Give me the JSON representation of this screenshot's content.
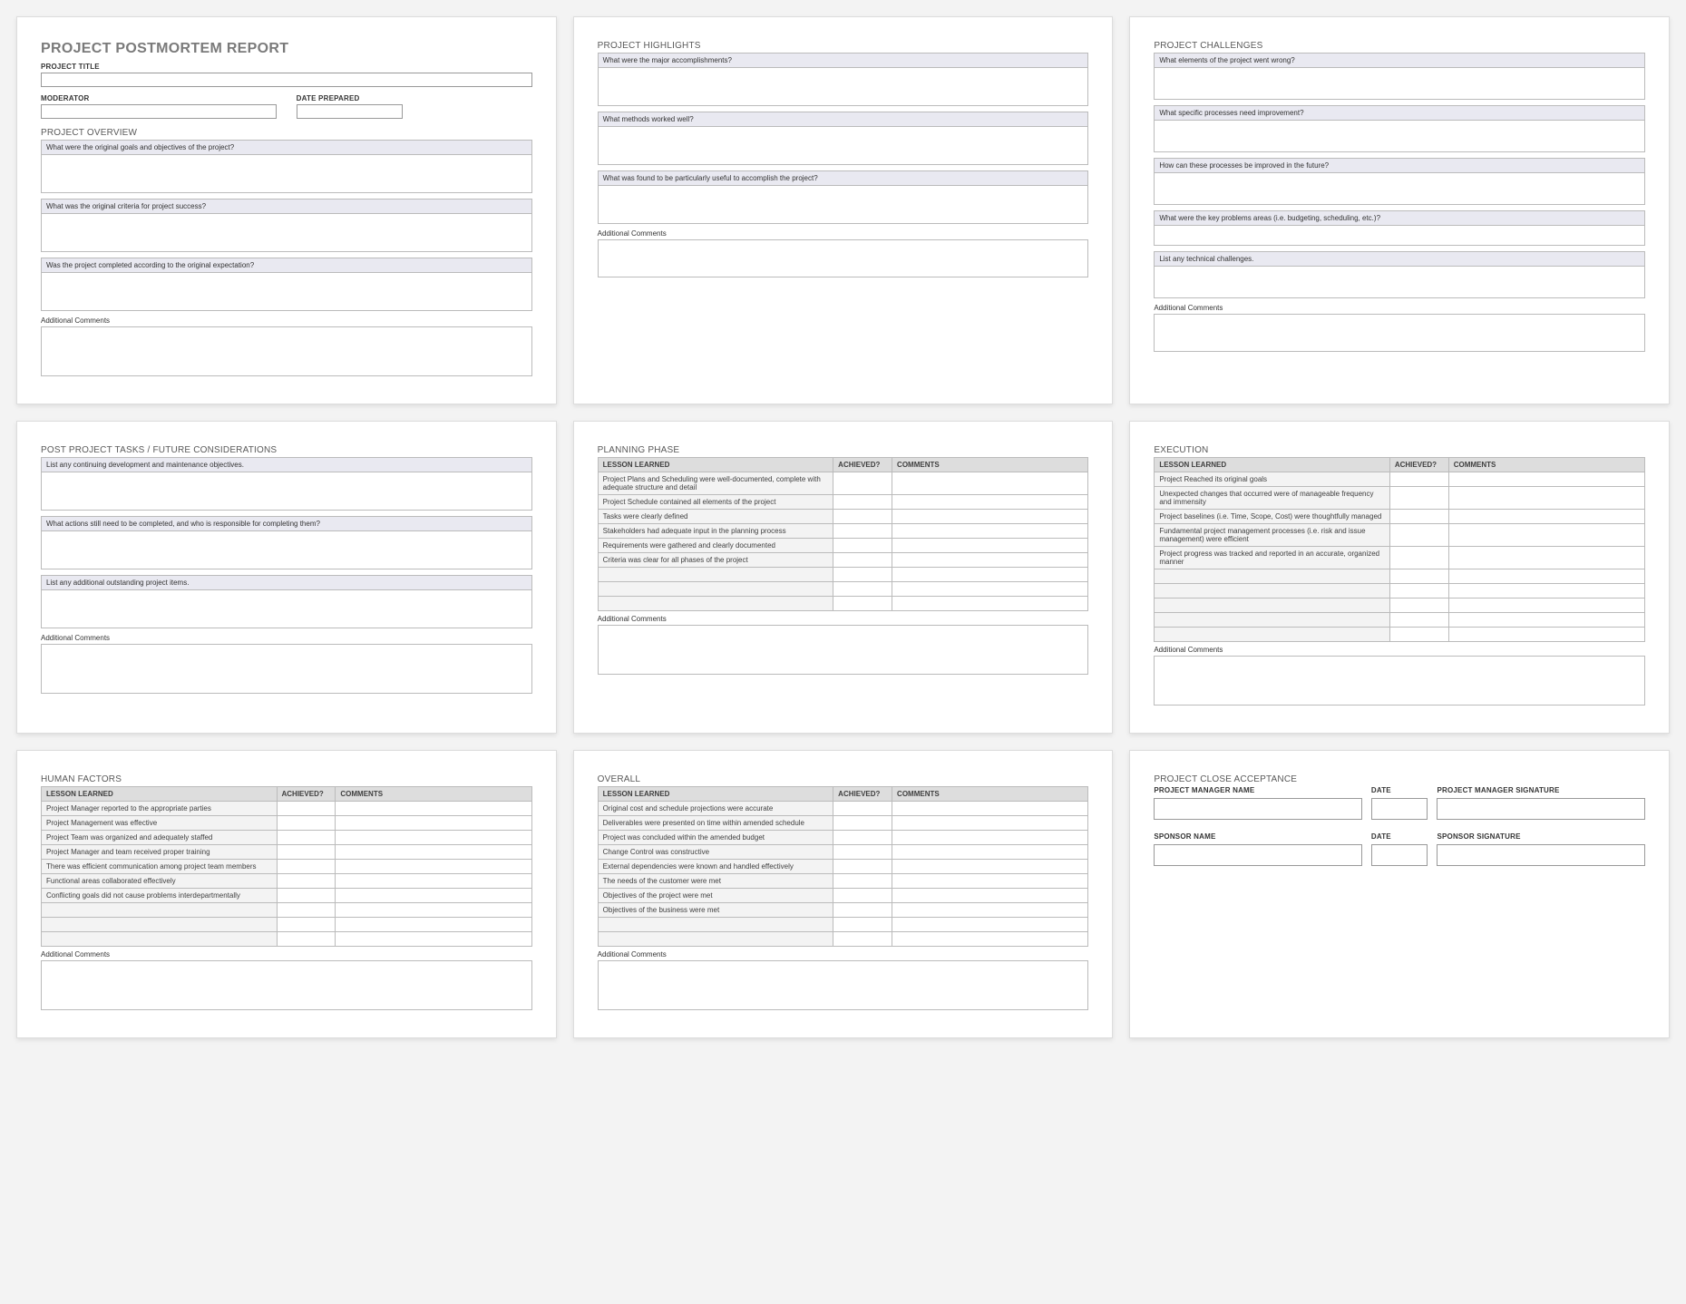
{
  "card1": {
    "title": "PROJECT POSTMORTEM REPORT",
    "project_title_label": "PROJECT TITLE",
    "moderator_label": "MODERATOR",
    "date_prepared_label": "DATE PREPARED",
    "overview_title": "PROJECT OVERVIEW",
    "q1": "What were the original goals and objectives of the project?",
    "q2": "What was the original criteria for project success?",
    "q3": "Was the project completed according to the original expectation?",
    "comments_label": "Additional Comments"
  },
  "card2": {
    "title": "PROJECT HIGHLIGHTS",
    "q1": "What were the major accomplishments?",
    "q2": "What methods worked well?",
    "q3": "What was found to be particularly useful to accomplish the project?",
    "comments_label": "Additional Comments"
  },
  "card3": {
    "title": "PROJECT CHALLENGES",
    "q1": "What elements of the project went wrong?",
    "q2": "What specific processes need improvement?",
    "q3": "How can these processes be improved in the future?",
    "q4": "What were the key problems areas (i.e. budgeting, scheduling, etc.)?",
    "q5": "List any technical challenges.",
    "comments_label": "Additional Comments"
  },
  "card4": {
    "title": "POST PROJECT TASKS / FUTURE CONSIDERATIONS",
    "q1": "List any continuing development and maintenance objectives.",
    "q2": "What actions still need to be completed, and who is responsible for completing them?",
    "q3": "List any additional outstanding project items.",
    "comments_label": "Additional Comments"
  },
  "card5": {
    "title": "PLANNING PHASE",
    "th1": "LESSON LEARNED",
    "th2": "ACHIEVED?",
    "th3": "COMMENTS",
    "rows": [
      "Project Plans and Scheduling were well-documented, complete with adequate structure and detail",
      "Project Schedule contained all elements of the project",
      "Tasks were clearly defined",
      "Stakeholders had adequate input in the planning process",
      "Requirements were gathered and clearly documented",
      "Criteria was clear for all phases of the project"
    ],
    "comments_label": "Additional Comments"
  },
  "card6": {
    "title": "EXECUTION",
    "th1": "LESSON LEARNED",
    "th2": "ACHIEVED?",
    "th3": "COMMENTS",
    "rows": [
      "Project Reached its original goals",
      "Unexpected changes that occurred were of manageable frequency and immensity",
      "Project baselines (i.e. Time, Scope, Cost) were thoughtfully managed",
      "Fundamental project management processes (i.e. risk and issue management) were efficient",
      "Project progress was tracked and reported in an accurate, organized manner"
    ],
    "comments_label": "Additional Comments"
  },
  "card7": {
    "title": "HUMAN FACTORS",
    "th1": "LESSON LEARNED",
    "th2": "ACHIEVED?",
    "th3": "COMMENTS",
    "rows": [
      "Project Manager reported to the appropriate parties",
      "Project Management was effective",
      "Project Team was organized and adequately staffed",
      "Project Manager and team received proper training",
      "There was efficient communication among project team members",
      "Functional areas collaborated effectively",
      "Conflicting goals did not cause problems interdepartmentally"
    ],
    "comments_label": "Additional Comments"
  },
  "card8": {
    "title": "OVERALL",
    "th1": "LESSON LEARNED",
    "th2": "ACHIEVED?",
    "th3": "COMMENTS",
    "rows": [
      "Original cost and schedule projections were accurate",
      "Deliverables were presented on time within amended schedule",
      "Project was concluded within the amended budget",
      "Change Control was constructive",
      "External dependencies were known and handled effectively",
      "The needs of the customer were met",
      "Objectives of the project were met",
      "Objectives of the business were met"
    ],
    "comments_label": "Additional Comments"
  },
  "card9": {
    "title": "PROJECT CLOSE ACCEPTANCE",
    "pm_name": "PROJECT MANAGER NAME",
    "date": "DATE",
    "pm_sig": "PROJECT MANAGER SIGNATURE",
    "sp_name": "SPONSOR NAME",
    "sp_sig": "SPONSOR SIGNATURE"
  }
}
